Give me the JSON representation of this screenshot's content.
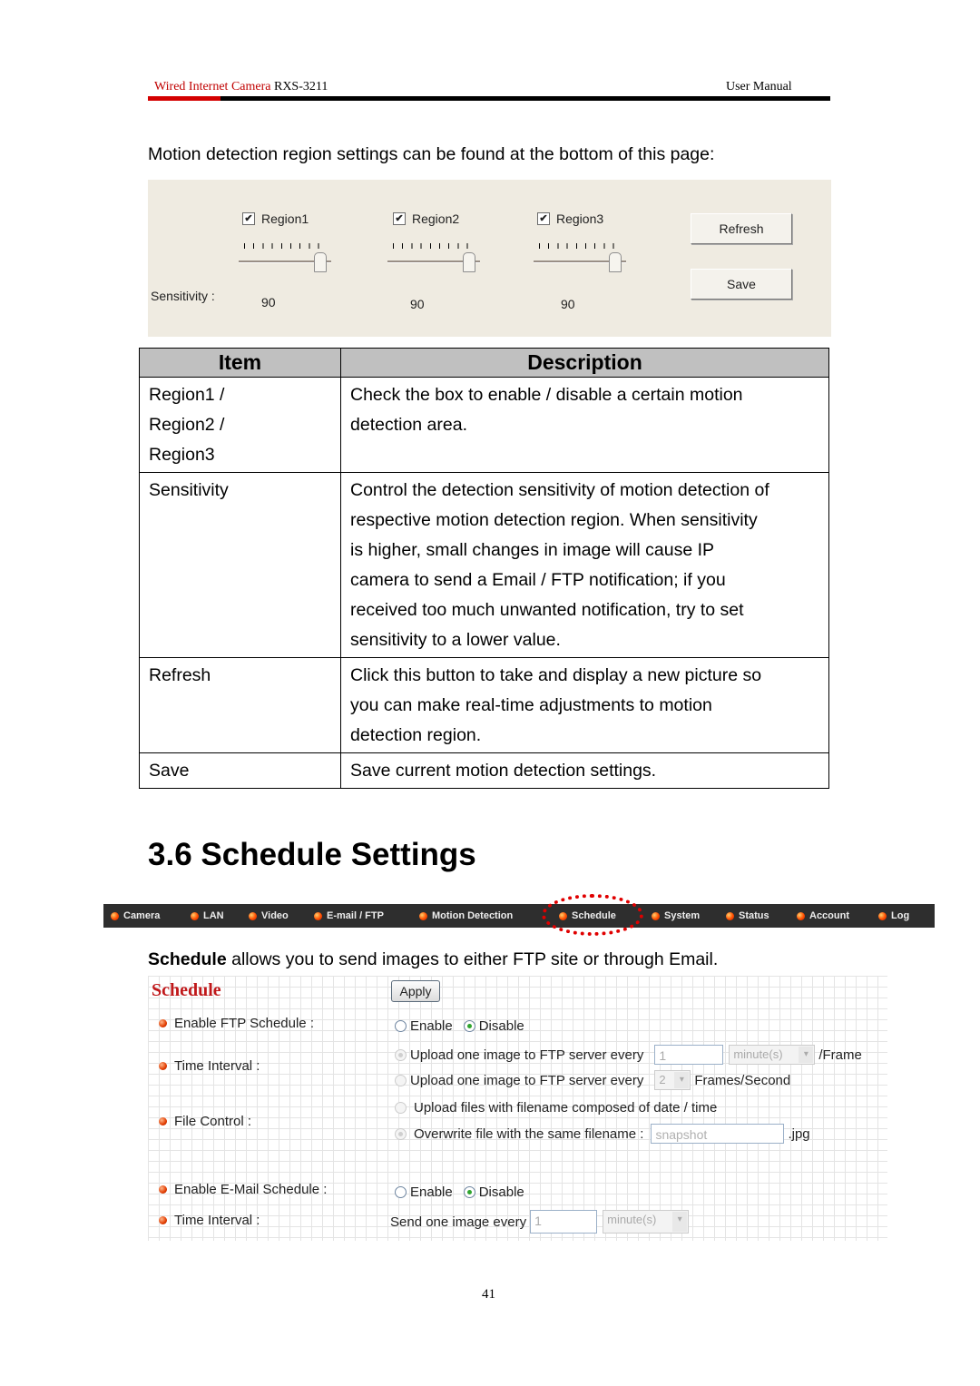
{
  "header": {
    "product": "Wired Internet Camera",
    "model": "RXS-3211",
    "doc_type": "User Manual"
  },
  "intro_text": "Motion detection region settings can be found at the bottom of this page:",
  "motion_panel": {
    "regions": [
      {
        "label": "Region1",
        "checked": true,
        "sensitivity": "90"
      },
      {
        "label": "Region2",
        "checked": true,
        "sensitivity": "90"
      },
      {
        "label": "Region3",
        "checked": true,
        "sensitivity": "90"
      }
    ],
    "sensitivity_label": "Sensitivity :",
    "check_glyph": "✔",
    "refresh_button": "Refresh",
    "save_button": "Save"
  },
  "table": {
    "headers": [
      "Item",
      "Description"
    ],
    "rows": [
      {
        "item": [
          "Region1 /",
          "Region2 /",
          "Region3"
        ],
        "description": [
          "Check the box to enable / disable a certain motion",
          "detection area."
        ]
      },
      {
        "item": [
          "Sensitivity"
        ],
        "description": [
          "Control the detection sensitivity of motion detection of",
          "respective motion detection region. When sensitivity",
          "is higher, small changes in image will cause IP",
          "camera to send a Email / FTP notification; if you",
          "received too much unwanted notification, try to set",
          "sensitivity to a lower value."
        ]
      },
      {
        "item": [
          "Refresh"
        ],
        "description": [
          "Click this button to take and display a new picture so",
          "you can make real-time adjustments to motion",
          "detection region."
        ]
      },
      {
        "item": [
          "Save"
        ],
        "description": [
          "Save current motion detection settings."
        ]
      }
    ]
  },
  "section_heading": "3.6 Schedule Settings",
  "nav": {
    "items": [
      "Camera",
      "LAN",
      "Video",
      "E-mail / FTP",
      "Motion Detection",
      "Schedule",
      "System",
      "Status",
      "Account",
      "Log"
    ],
    "highlighted": "Schedule",
    "highlight_color": "#e00000"
  },
  "schedule_intro": {
    "bold": "Schedule",
    "rest": " allows you to send images to either FTP site or through Email."
  },
  "schedule_form": {
    "title": "Schedule",
    "apply_button": "Apply",
    "labels": {
      "enable_ftp": "Enable FTP Schedule :",
      "time_interval": "Time Interval :",
      "file_control": "File Control :",
      "enable_email": "Enable E-Mail Schedule :",
      "email_interval": "Time Interval :"
    },
    "enable_label": "Enable",
    "disable_label": "Disable",
    "ftp_enabled": false,
    "ftp_interval": {
      "option1_text": "Upload one image to FTP server every",
      "option1_value": "1",
      "option1_unit": "minute(s)",
      "option1_suffix": "/Frame",
      "option2_text": "Upload one image to FTP server every",
      "option2_value": "2",
      "option2_suffix": "Frames/Second",
      "selected": 1
    },
    "file_control": {
      "option1_text": "Upload files with filename composed of date / time",
      "option2_text": "Overwrite file with the same filename :",
      "filename_placeholder": "snapshot",
      "extension": ".jpg",
      "selected": 2
    },
    "email_enabled": false,
    "email_interval": {
      "text": "Send one image every",
      "value": "1",
      "unit": "minute(s)"
    }
  },
  "page_number": "41"
}
